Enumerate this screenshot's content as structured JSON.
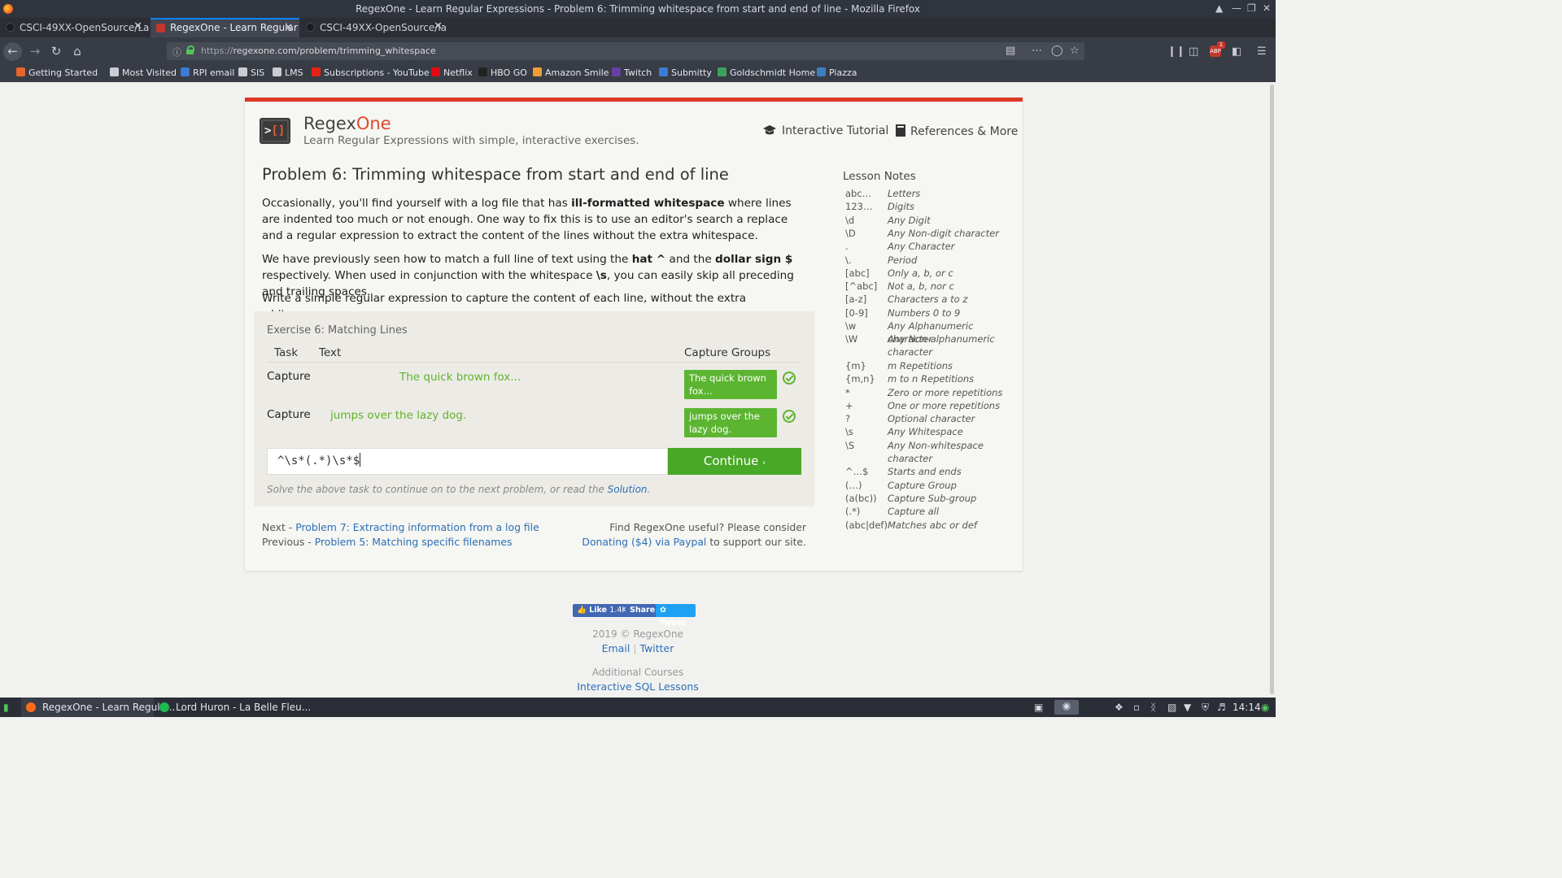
{
  "window": {
    "title": "RegexOne - Learn Regular Expressions - Problem 6: Trimming whitespace from start and end of line - Mozilla Firefox"
  },
  "tabs": [
    {
      "label": "CSCI-49XX-OpenSource/La",
      "active": false
    },
    {
      "label": "RegexOne - Learn Regular",
      "active": true
    },
    {
      "label": "CSCI-49XX-OpenSource/la",
      "active": false
    }
  ],
  "urlbar": {
    "scheme": "https://",
    "host_path": "regexone.com/problem/trimming_whitespace"
  },
  "bookmarks": [
    {
      "label": "Getting Started",
      "icon": "firefox-icon",
      "color": "#e8642c"
    },
    {
      "label": "Most Visited",
      "icon": "gear-icon",
      "color": "#c9ccd2"
    },
    {
      "label": "RPI email",
      "icon": "globe-icon",
      "color": "#3a7bd5"
    },
    {
      "label": "SIS",
      "icon": "globe-icon",
      "color": "#c9ccd2"
    },
    {
      "label": "LMS",
      "icon": "lms-icon",
      "color": "#c9ccd2"
    },
    {
      "label": "Subscriptions - YouTube",
      "icon": "youtube-icon",
      "color": "#e62117"
    },
    {
      "label": "Netflix",
      "icon": "netflix-icon",
      "color": "#e50914"
    },
    {
      "label": "HBO GO",
      "icon": "hbo-icon",
      "color": "#222222"
    },
    {
      "label": "Amazon Smile",
      "icon": "amazon-icon",
      "color": "#f19e39"
    },
    {
      "label": "Twitch",
      "icon": "twitch-icon",
      "color": "#6441a5"
    },
    {
      "label": "Submitty",
      "icon": "submitty-icon",
      "color": "#3a7bd5"
    },
    {
      "label": "Goldschmidt Home",
      "icon": "g-icon",
      "color": "#3aa35a"
    },
    {
      "label": "Piazza",
      "icon": "piazza-icon",
      "color": "#3e7ec0"
    }
  ],
  "site": {
    "brand_main": "Regex",
    "brand_accent": "One",
    "tagline": "Learn Regular Expressions with simple, interactive exercises.",
    "nav_tutorial": "Interactive Tutorial",
    "nav_refs": "References & More",
    "accent_color": "#dd3722"
  },
  "problem": {
    "title": "Problem 6: Trimming whitespace from start and end of line",
    "p1_a": "Occasionally, you'll find yourself with a log file that has ",
    "p1_b": "ill-formatted whitespace",
    "p1_c": " where lines are indented too much or not enough. One way to fix this is to use an editor's search a replace and a regular expression to extract the content of the lines without the extra whitespace.",
    "p2_a": "We have previously seen how to match a full line of text using the ",
    "p2_b": "hat ^",
    "p2_c": " and the ",
    "p2_d": "dollar sign $",
    "p2_e": " respectively. When used in conjunction with the whitespace ",
    "p2_f": "\\s",
    "p2_g": ", you can easily skip all preceding and trailing spaces.",
    "p3": "Write a simple regular expression to capture the content of each line, without the extra whitespace."
  },
  "exercise": {
    "title": "Exercise 6: Matching Lines",
    "col_task": "Task",
    "col_text": "Text",
    "col_groups": "Capture Groups",
    "rows": [
      {
        "task": "Capture",
        "text": "The quick brown fox...",
        "group": "The quick brown fox..."
      },
      {
        "task": "Capture",
        "text": "jumps over the lazy dog.",
        "group": "jumps over the lazy dog."
      }
    ],
    "input_value": "^\\s*(.*)\\s*$",
    "continue_label": "Continue",
    "hint_prefix": "Solve the above task to continue on to the next problem, or read the ",
    "hint_link": "Solution",
    "hint_suffix": "."
  },
  "pager": {
    "next_prefix": "Next - ",
    "next_link": "Problem 7: Extracting information from a log file",
    "prev_prefix": "Previous - ",
    "prev_link": "Problem 5: Matching specific filenames",
    "support_line1": "Find RegexOne useful? Please consider",
    "support_link": "Donating ($4) via Paypal",
    "support_suffix": " to support our site."
  },
  "lesson_notes": {
    "title": "Lesson Notes",
    "items": [
      {
        "k": "abc…",
        "v": "Letters"
      },
      {
        "k": "123…",
        "v": "Digits"
      },
      {
        "k": "\\d",
        "v": "Any Digit"
      },
      {
        "k": "\\D",
        "v": "Any Non-digit character"
      },
      {
        "k": ".",
        "v": "Any Character"
      },
      {
        "k": "\\.",
        "v": "Period"
      },
      {
        "k": "[abc]",
        "v": "Only a, b, or c"
      },
      {
        "k": "[^abc]",
        "v": "Not a, b, nor c"
      },
      {
        "k": "[a-z]",
        "v": "Characters a to z"
      },
      {
        "k": "[0-9]",
        "v": "Numbers 0 to 9"
      },
      {
        "k": "\\w",
        "v": "Any Alphanumeric character"
      },
      {
        "k": "\\W",
        "v": "Any Non-alphanumeric character"
      },
      {
        "k": "{m}",
        "v": "m Repetitions"
      },
      {
        "k": "{m,n}",
        "v": "m to n Repetitions"
      },
      {
        "k": "*",
        "v": "Zero or more repetitions"
      },
      {
        "k": "+",
        "v": "One or more repetitions"
      },
      {
        "k": "?",
        "v": "Optional character"
      },
      {
        "k": "\\s",
        "v": "Any Whitespace"
      },
      {
        "k": "\\S",
        "v": "Any Non-whitespace character"
      },
      {
        "k": "^…$",
        "v": "Starts and ends"
      },
      {
        "k": "(…)",
        "v": "Capture Group"
      },
      {
        "k": "(a(bc))",
        "v": "Capture Sub-group"
      },
      {
        "k": "(.*)",
        "v": "Capture all"
      },
      {
        "k": "(abc|def)",
        "v": "Matches abc or def"
      }
    ]
  },
  "social": {
    "like_label": "Like",
    "like_count": "1.4K",
    "share_label": "Share",
    "tweet_label": "Tweet"
  },
  "footer": {
    "copyright": "2019 © RegexOne",
    "email": "Email",
    "sep": "|",
    "twitter": "Twitter",
    "additional": "Additional Courses",
    "sql": "Interactive SQL Lessons"
  },
  "taskbar": {
    "items": [
      {
        "label": "RegexOne - Learn Regula...",
        "icon": "firefox-icon"
      },
      {
        "label": "Lord Huron - La Belle Fleu...",
        "icon": "spotify-icon"
      }
    ],
    "clock": "14:14"
  }
}
